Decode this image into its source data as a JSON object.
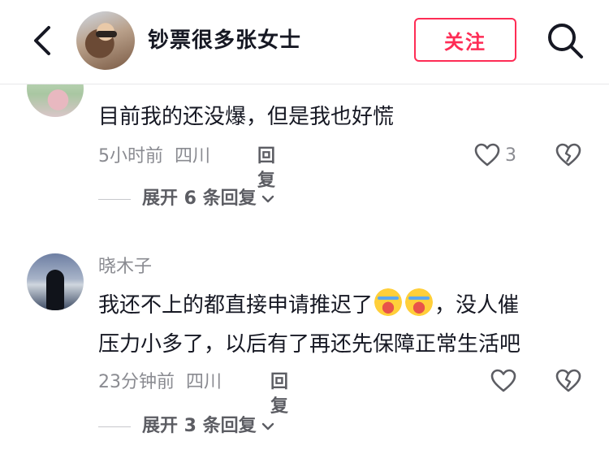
{
  "header": {
    "title": "钞票很多张女士",
    "follow_label": "关注"
  },
  "comments": [
    {
      "username": "",
      "text": "目前我的还没爆，但是我也好慌",
      "time": "5小时前",
      "location": "四川",
      "reply_label": "回复",
      "likes": "3",
      "expand_label": "展开 6 条回复"
    },
    {
      "username": "晓木子",
      "text_line1": "我还不上的都直接申请推迟了",
      "text_line1_after": "，没人催",
      "text_line2": "压力小多了，以后有了再还先保障正常生活吧",
      "time": "23分钟前",
      "location": "四川",
      "reply_label": "回复",
      "likes": "",
      "expand_label": "展开 3 条回复"
    }
  ],
  "icons": {
    "back": "chevron-left-icon",
    "search": "search-icon",
    "like": "heart-outline-icon",
    "dislike": "broken-heart-icon",
    "expand": "chevron-down-icon",
    "emoji": "crying-laughing-emoji"
  },
  "colors": {
    "accent": "#fe2c55",
    "text_primary": "#161823",
    "text_secondary": "#8a8b91"
  }
}
